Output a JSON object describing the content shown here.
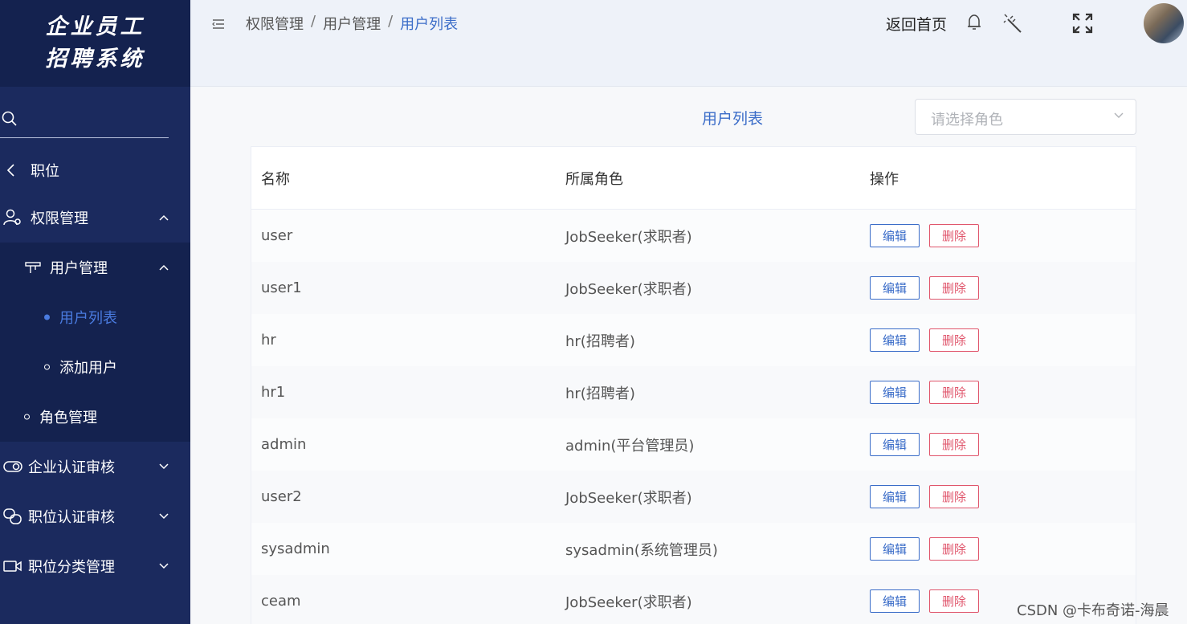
{
  "sidebar": {
    "logo_line1": "企业员工",
    "logo_line2": "招聘系统",
    "back_label": "职位",
    "menu": {
      "permission": "权限管理",
      "user_management": "用户管理",
      "user_list": "用户列表",
      "add_user": "添加用户",
      "role_management": "角色管理",
      "company_audit": "企业认证审核",
      "position_audit": "职位认证审核",
      "position_category": "职位分类管理"
    }
  },
  "header": {
    "breadcrumb": [
      "权限管理",
      "用户管理",
      "用户列表"
    ],
    "breadcrumb_sep": "/",
    "home_link": "返回首页"
  },
  "main": {
    "title": "用户列表",
    "role_select": {
      "placeholder": "请选择角色"
    },
    "table": {
      "headers": [
        "名称",
        "所属角色",
        "操作"
      ],
      "edit_label": "编辑",
      "delete_label": "删除",
      "rows": [
        {
          "name": "user",
          "role": "JobSeeker(求职者)"
        },
        {
          "name": "user1",
          "role": "JobSeeker(求职者)"
        },
        {
          "name": "hr",
          "role": "hr(招聘者)"
        },
        {
          "name": "hr1",
          "role": "hr(招聘者)"
        },
        {
          "name": "admin",
          "role": "admin(平台管理员)"
        },
        {
          "name": "user2",
          "role": "JobSeeker(求职者)"
        },
        {
          "name": "sysadmin",
          "role": "sysadmin(系统管理员)"
        },
        {
          "name": "ceam",
          "role": "JobSeeker(求职者)"
        }
      ]
    }
  },
  "watermark": "CSDN @卡布奇诺-海晨",
  "colors": {
    "sidebar": "#1b2a5e",
    "sidebar_dark": "#14224f",
    "accent": "#3a6cc8",
    "danger": "#e0566c"
  }
}
